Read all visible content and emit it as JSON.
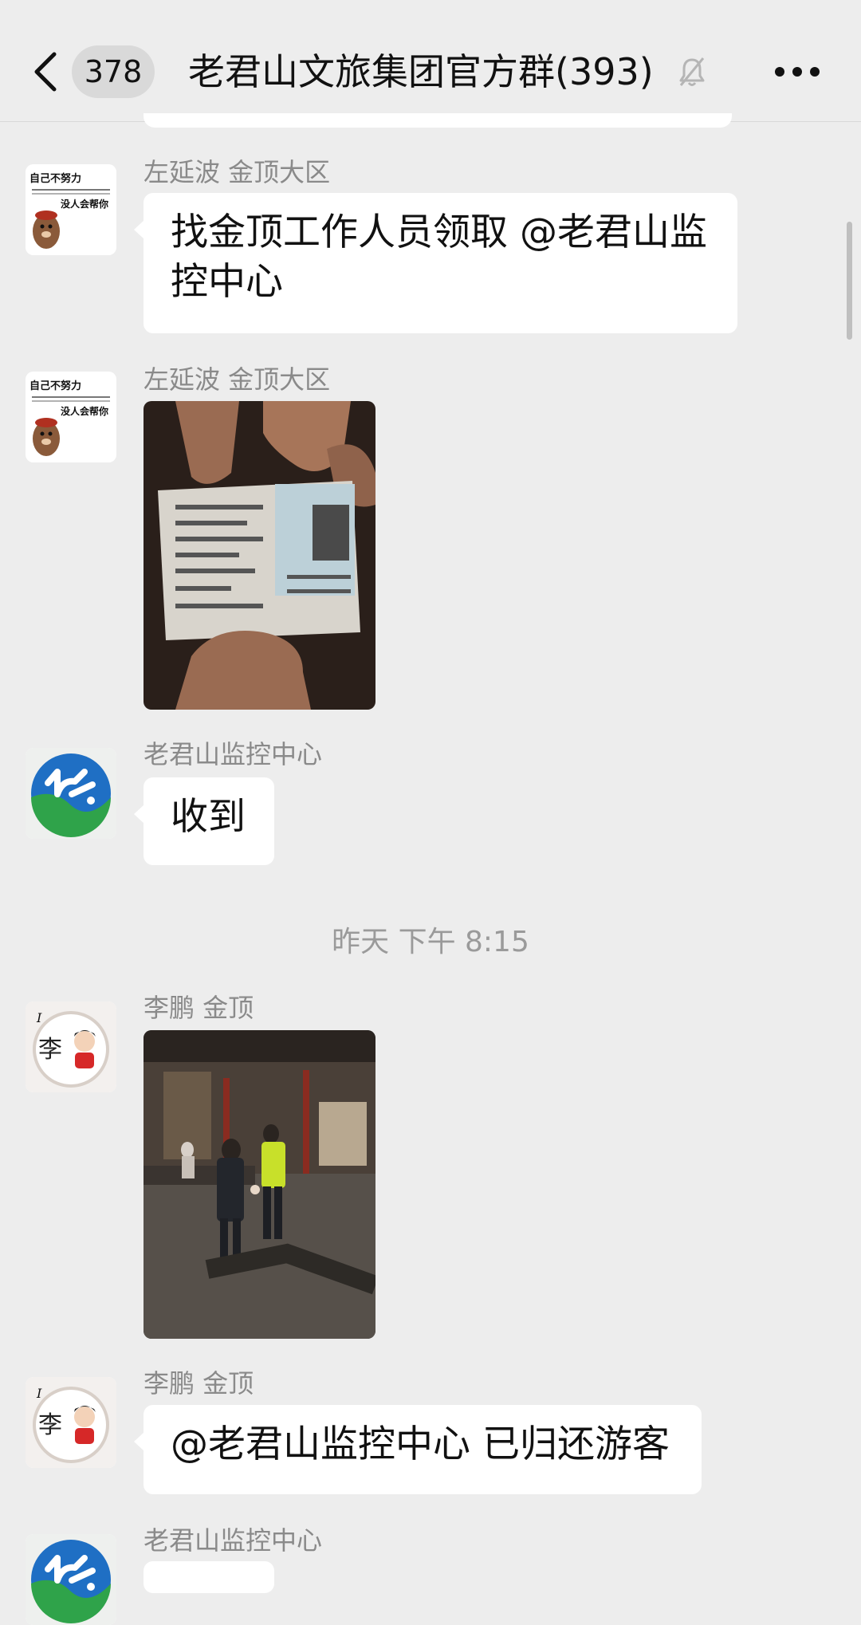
{
  "header": {
    "unread_count": "378",
    "title": "老君山文旅集团官方群(393)"
  },
  "messages": [
    {
      "sender": "左延波   金顶大区",
      "text": "找金顶工作人员领取 @老君山监控中心",
      "avatar": "bear-meme-avatar"
    },
    {
      "sender": "左延波   金顶大区",
      "image": "id-card-photo",
      "avatar": "bear-meme-avatar"
    },
    {
      "sender": "老君山监控中心",
      "text": "收到",
      "avatar": "monitoring-center-logo"
    },
    {
      "sender": "李鹏   金顶",
      "image": "night-plaza-photo",
      "avatar": "cartoon-li-avatar"
    },
    {
      "sender": "李鹏   金顶",
      "text": "@老君山监控中心 已归还游客",
      "avatar": "cartoon-li-avatar"
    },
    {
      "sender": "老君山监控中心",
      "avatar": "monitoring-center-logo"
    }
  ],
  "time_divider": "昨天 下午 8:15",
  "avatar_texts": {
    "bear_top": "自己不努力",
    "bear_bottom": "没人会帮你",
    "cartoon_char": "李"
  },
  "colors": {
    "background": "#ededed",
    "bubble": "#ffffff",
    "sender_text": "#8a8a8a",
    "logo_blue": "#1f6fc4",
    "logo_green": "#2fa34a"
  }
}
